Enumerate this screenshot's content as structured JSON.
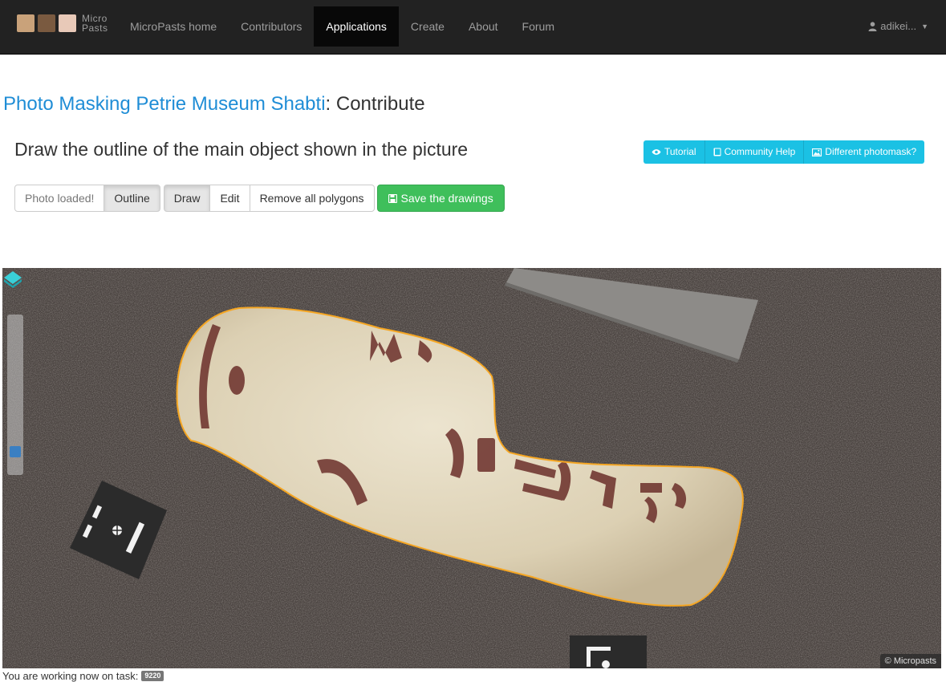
{
  "navbar": {
    "brand_line1": "Micro",
    "brand_line2": "Pasts",
    "items": [
      {
        "label": "MicroPasts home",
        "active": false
      },
      {
        "label": "Contributors",
        "active": false
      },
      {
        "label": "Applications",
        "active": true
      },
      {
        "label": "Create",
        "active": false
      },
      {
        "label": "About",
        "active": false
      },
      {
        "label": "Forum",
        "active": false
      }
    ],
    "user": "adikei...",
    "user_icon": "user-icon",
    "background_color": "#222222",
    "active_color": "#080808"
  },
  "title": {
    "app_name": "Photo Masking Petrie Museum Shabti",
    "suffix": ": Contribute",
    "link_color": "#1f8dd6"
  },
  "question": "Draw the outline of the main object shown in the picture",
  "help_buttons": [
    {
      "label": "Tutorial",
      "icon": "eye-icon"
    },
    {
      "label": "Community Help",
      "icon": "book-icon"
    },
    {
      "label": "Different photomask?",
      "icon": "picture-icon"
    }
  ],
  "help_color": "#1bc1e4",
  "toolbar": {
    "status": "Photo loaded!",
    "outline": "Outline",
    "draw": "Draw",
    "edit": "Edit",
    "remove": "Remove all polygons",
    "save": "Save the drawings",
    "save_icon": "floppy-disk-icon",
    "save_color": "#3fbf5b"
  },
  "map": {
    "attribution": "© Micropasts",
    "outline_color": "#f5a623"
  },
  "footer": {
    "task_text": "You are working now on task:",
    "task_id": "9220"
  }
}
